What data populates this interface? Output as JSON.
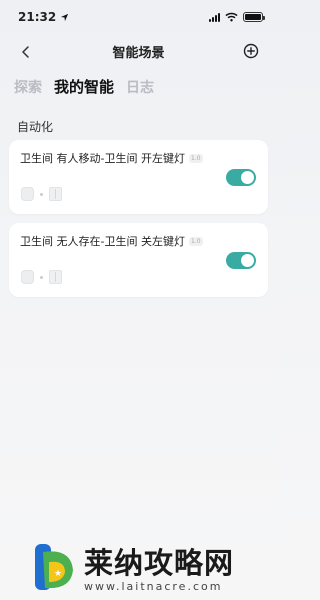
{
  "status_bar": {
    "time": "21:32",
    "location_icon": "location-arrow-icon",
    "signal_icon": "signal-icon",
    "wifi_icon": "wifi-icon",
    "battery_icon": "battery-icon"
  },
  "nav": {
    "back_icon": "chevron-left-icon",
    "title": "智能场景",
    "add_icon": "plus-circle-icon"
  },
  "tabs": [
    {
      "label": "探索",
      "active": false
    },
    {
      "label": "我的智能",
      "active": true
    },
    {
      "label": "日志",
      "active": false
    }
  ],
  "section": {
    "title": "自动化"
  },
  "automations": [
    {
      "title": "卫生间 有人移动-卫生间 开左键灯",
      "version": "1.0",
      "enabled": true
    },
    {
      "title": "卫生间 无人存在-卫生间 关左键灯",
      "version": "1.0",
      "enabled": true
    }
  ],
  "colors": {
    "toggle_on": "#3aaba3",
    "tab_inactive": "#b9bcc2",
    "tab_active": "#111111"
  },
  "watermark": {
    "text": "莱纳攻略网",
    "url": "www.laitnacre.com"
  }
}
